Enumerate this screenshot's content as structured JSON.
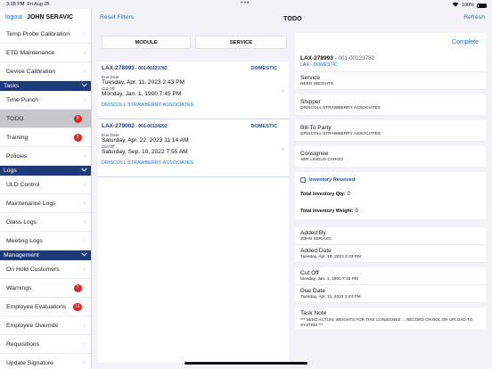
{
  "status_bar": {
    "time": "3:28 PM",
    "date": "Fri Aug 25",
    "battery": "100%"
  },
  "sidebar": {
    "logout_label": "logout",
    "user_name": "JOHN SERAVIC",
    "top_items": [
      {
        "label": "Temp Probe Calibration"
      },
      {
        "label": "ETD Maintenance"
      },
      {
        "label": "Device Calibration"
      }
    ],
    "sections": [
      {
        "label": "Tasks",
        "items": [
          {
            "label": "Time Punch",
            "badge": ""
          },
          {
            "label": "TODO",
            "badge": "9",
            "active": true
          },
          {
            "label": "Training",
            "badge": "2"
          },
          {
            "label": "Policies",
            "badge": ""
          }
        ]
      },
      {
        "label": "Logs",
        "items": [
          {
            "label": "ULD Control",
            "badge": ""
          },
          {
            "label": "Maintenance Logs",
            "badge": ""
          },
          {
            "label": "Glass Logs",
            "badge": ""
          },
          {
            "label": "Meeting Logs",
            "badge": ""
          }
        ]
      },
      {
        "label": "Management",
        "items": [
          {
            "label": "On Hold Customers",
            "badge": ""
          },
          {
            "label": "Warnings",
            "badge": "7"
          },
          {
            "label": "Employee Evaluations",
            "badge": "16"
          },
          {
            "label": "Employee Override",
            "badge": ""
          },
          {
            "label": "Requisitions",
            "badge": ""
          },
          {
            "label": "Update Signature",
            "badge": ""
          }
        ]
      }
    ]
  },
  "nav": {
    "reset_label": "Reset Filters",
    "title": "TODO",
    "refresh_label": "Refresh"
  },
  "filters": {
    "module_label": "MODULE",
    "service_label": "SERVICE"
  },
  "list": [
    {
      "id": "LAX-278993",
      "sub": " - 001-00123782",
      "type": "DOMESTIC",
      "due_label": "Due Date",
      "due": "Tuesday, Apr. 11, 2023 2:43 PM",
      "cutoff_label": "Cut Off",
      "cutoff": "Monday, Jan. 1, 1900 7:45 PM",
      "customer": "DRISCOLL STRAWBERRY ASSOCIATES"
    },
    {
      "id": "LAX-279002",
      "sub": " - 001-00124202",
      "type": "DOMESTIC",
      "due_label": "Due Date",
      "due": "Saturday, Apr. 22, 2023 11:14 AM",
      "cutoff_label": "Cut Off",
      "cutoff": "Saturday, Sep. 10, 2022 7:55 AM",
      "customer": "DRISCOLL STRAWBERRY ASSOCIATES"
    }
  ],
  "detail": {
    "complete_label": "Complete",
    "header": {
      "id": "LAX-278993",
      "sub": " - 001-00123782",
      "origin": "LAX",
      "dash": " - ",
      "type": "DOMESTIC"
    },
    "service": {
      "label": "Service",
      "value": "NEED WEIGHTS"
    },
    "shipper": {
      "label": "Shipper",
      "value": "DRISCOLL STRAWBERRY ASSOCIATES"
    },
    "bill_to": {
      "label": "Bill To Party",
      "value": "DRISCOLL STRAWBERRY ASSOCIATES"
    },
    "consignee": {
      "label": "Consignee",
      "value": "AER LINGUS CARGO"
    },
    "inventory": {
      "received_label": "Inventory Received",
      "qty_label": "Total Inventory Qty:",
      "qty_value": "0",
      "weight_label": "Total Inventory Weight:",
      "weight_value": "0"
    },
    "added_by": {
      "label": "Added By",
      "value": "JOHN SERAVIC"
    },
    "added_date": {
      "label": "Added Date",
      "value": "Tuesday, Apr. 10, 2023 2:43 PM"
    },
    "cut_off": {
      "label": "Cut Off",
      "value": "Monday, Jan. 1, 1900 7:45 PM"
    },
    "due_date": {
      "label": "Due Date",
      "value": "Tuesday, Apr. 11, 2023 2:43 PM"
    },
    "task_note": {
      "label": "Task Note",
      "value": "*** NEED ACTUAL WEIGHTS FOR THIS CONSIGNEE ... RECORD ON BOL OR UPLOAD TO SYSTEM ***"
    }
  }
}
